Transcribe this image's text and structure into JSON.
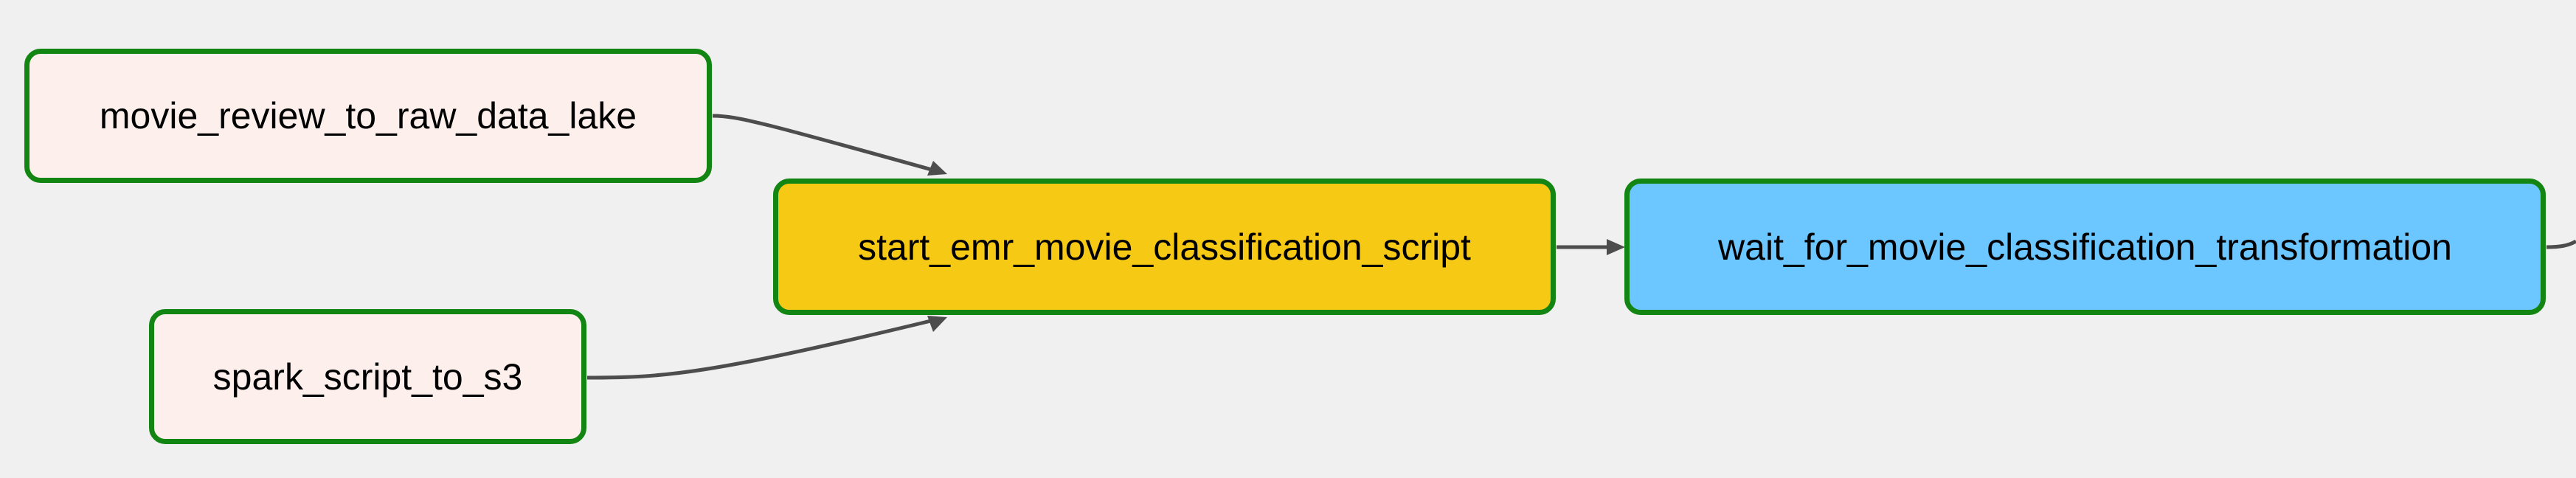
{
  "colors": {
    "background": "#f0f0f0",
    "node_border": "#138513",
    "edge": "#4d4d4d",
    "state_none": "#fdf0ec",
    "state_queued": "#f6c914",
    "state_running": "#6cc6ff"
  },
  "nodes": [
    {
      "id": "movie_review_to_raw_data_lake",
      "label": "movie_review_to_raw_data_lake",
      "fill": "#fdf0ec"
    },
    {
      "id": "spark_script_to_s3",
      "label": "spark_script_to_s3",
      "fill": "#fdf0ec"
    },
    {
      "id": "start_emr_movie_classification_script",
      "label": "start_emr_movie_classification_script",
      "fill": "#f6c914"
    },
    {
      "id": "wait_for_movie_classification_transformation",
      "label": "wait_for_movie_classification_transformation",
      "fill": "#6cc6ff"
    }
  ],
  "edges": [
    {
      "from": "movie_review_to_raw_data_lake",
      "to": "start_emr_movie_classification_script"
    },
    {
      "from": "spark_script_to_s3",
      "to": "start_emr_movie_classification_script"
    },
    {
      "from": "start_emr_movie_classification_script",
      "to": "wait_for_movie_classification_transformation"
    },
    {
      "from": "wait_for_movie_classification_transformation",
      "to": ""
    }
  ]
}
